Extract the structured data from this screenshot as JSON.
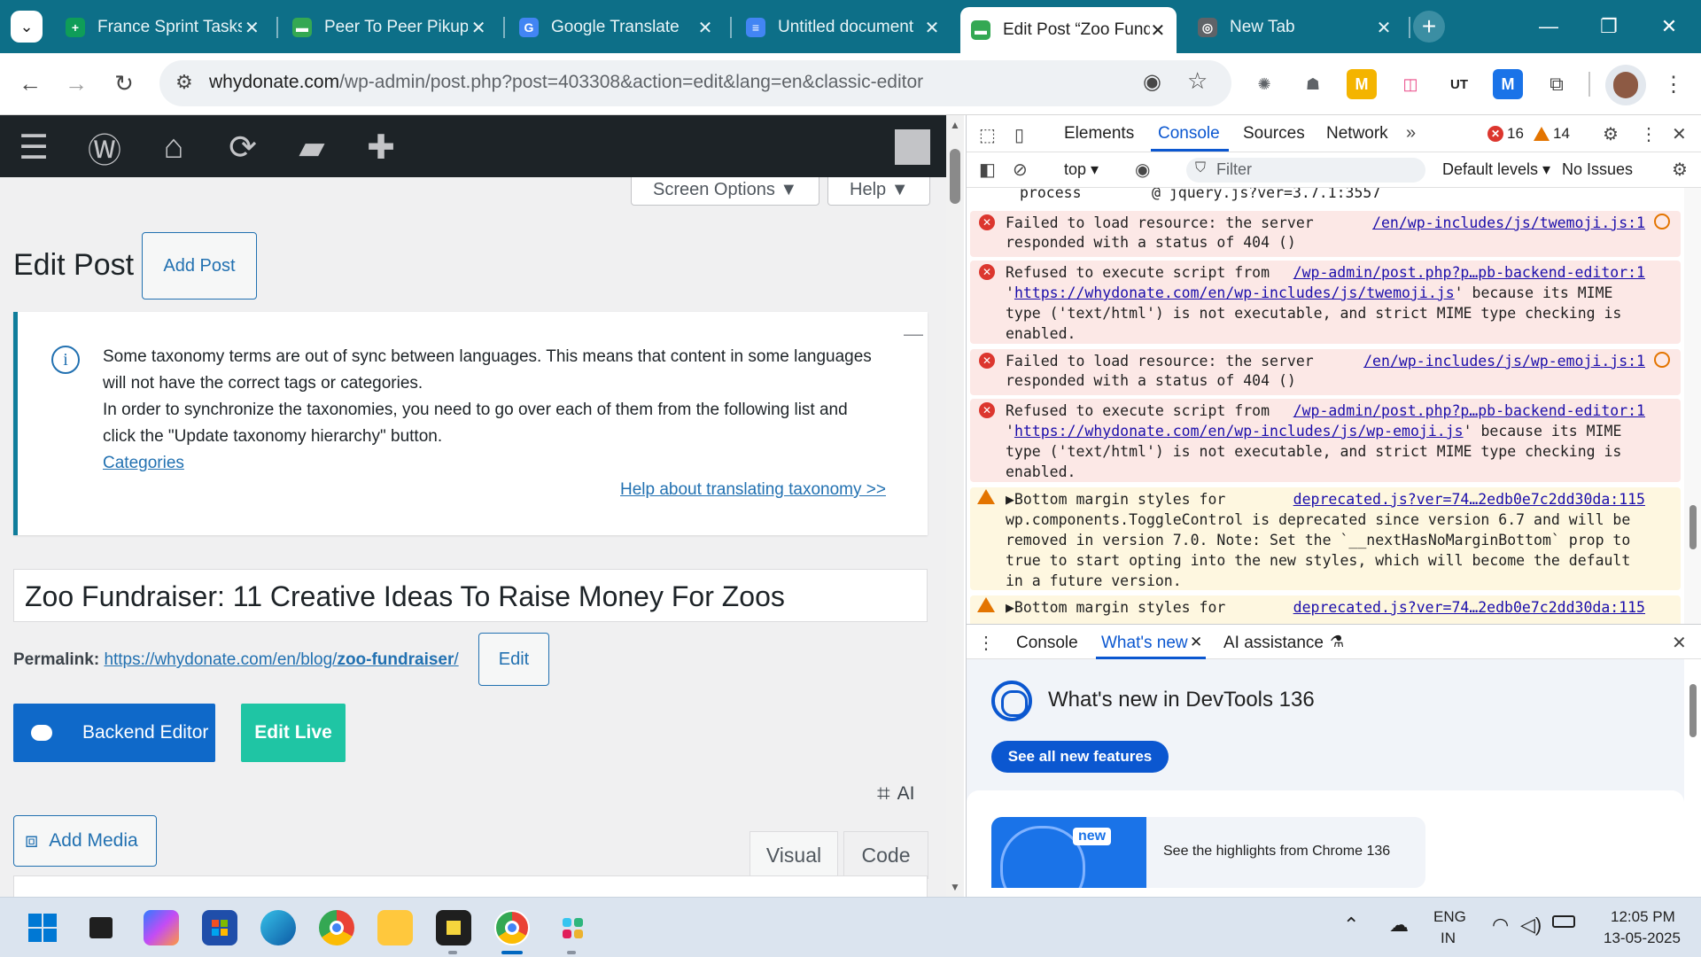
{
  "browser": {
    "tabs": [
      {
        "title": "France Sprint Tasks",
        "color": "#0f9d58",
        "glyph": "+"
      },
      {
        "title": "Peer To Peer Pikup",
        "color": "#34a853",
        "glyph": "▬"
      },
      {
        "title": "Google Translate",
        "color": "#4285f4",
        "glyph": "G"
      },
      {
        "title": "Untitled document",
        "color": "#4285f4",
        "glyph": "≡"
      },
      {
        "title": "Edit Post “Zoo Fundraiser",
        "color": "#34a853",
        "glyph": "▬"
      },
      {
        "title": "New Tab",
        "color": "#5f6368",
        "glyph": "◎"
      }
    ],
    "address": {
      "host": "whydonate.com",
      "path": "/wp-admin/post.php?post=403308&action=edit&lang=en&classic-editor"
    }
  },
  "wp": {
    "screen_options": "Screen Options ▼",
    "help": "Help ▼",
    "heading": "Edit Post",
    "add_post": "Add Post",
    "notice": {
      "line1": "Some taxonomy terms are out of sync between languages. This means that content in some languages",
      "line2": "will not have the correct tags or categories.",
      "line3": "In order to synchronize the taxonomies, you need to go over each of them from the following list and",
      "line4": "click the \"Update taxonomy hierarchy\" button.",
      "categories_link": "Categories",
      "help_link": "Help about translating taxonomy >>",
      "dismiss": "—",
      "info_glyph": "i"
    },
    "post_title": "Zoo Fundraiser: 11 Creative Ideas To Raise Money For Zoos",
    "permalink_label": "Permalink:",
    "permalink_prefix": "https://whydonate.com/en/blog/",
    "permalink_slug": "zoo-fundraiser",
    "permalink_suffix": "/",
    "edit": "Edit",
    "backend_editor": "Backend Editor",
    "edit_live": "Edit Live",
    "ai": "AI",
    "add_media": "Add Media",
    "visual": "Visual",
    "code": "Code"
  },
  "devtools": {
    "tabs": [
      "Elements",
      "Console",
      "Sources",
      "Network"
    ],
    "error_count": "16",
    "warning_count": "14",
    "context": "top ▾",
    "filter_placeholder": "Filter",
    "levels": "Default levels ▾",
    "issues": "No Issues",
    "console": {
      "top_partial": "process        @ jquery.js?ver=3.7.1:3557",
      "messages": [
        {
          "level": "error",
          "lines": [
            "Failed to load resource: the server",
            "responded with a status of 404 ()"
          ],
          "source": "/en/wp-includes/js/twemoji.js:1"
        },
        {
          "level": "error",
          "lines": [
            "Refused to execute script from",
            "' because its MIME",
            "type ('text/html') is not executable, and strict MIME type checking is",
            "enabled."
          ],
          "inline_link": "https://whydonate.com/en/wp-includes/js/twemoji.js",
          "source": "/wp-admin/post.php?p…pb-backend-editor:1"
        },
        {
          "level": "error",
          "lines": [
            "Failed to load resource: the server",
            "responded with a status of 404 ()"
          ],
          "source": "/en/wp-includes/js/wp-emoji.js:1"
        },
        {
          "level": "error",
          "lines": [
            "Refused to execute script from",
            "' because its MIME",
            "type ('text/html') is not executable, and strict MIME type checking is",
            "enabled."
          ],
          "inline_link": "https://whydonate.com/en/wp-includes/js/wp-emoji.js",
          "source": "/wp-admin/post.php?p…pb-backend-editor:1"
        },
        {
          "level": "warning",
          "lines": [
            "▶Bottom margin styles for",
            "wp.components.ToggleControl is deprecated since version 6.7 and will be",
            "removed in version 7.0. Note: Set the `__nextHasNoMarginBottom` prop to",
            "true to start opting into the new styles, which will become the default",
            "in a future version."
          ],
          "source": "deprecated.js?ver=74…2edb0e7c2dd30da:115"
        },
        {
          "level": "warning",
          "lines": [
            "▶Bottom margin styles for"
          ],
          "source": "deprecated.js?ver=74…2edb0e7c2dd30da:115"
        }
      ]
    },
    "drawer": {
      "tabs": [
        "Console",
        "What's new",
        "AI assistance"
      ],
      "whatsnew_title": "What's new in DevTools 136",
      "see_all": "See all new features",
      "badge": "new",
      "highlight": "See the highlights from Chrome 136"
    }
  },
  "taskbar": {
    "lang": "ENG",
    "region": "IN",
    "time": "12:05 PM",
    "date": "13-05-2025"
  }
}
